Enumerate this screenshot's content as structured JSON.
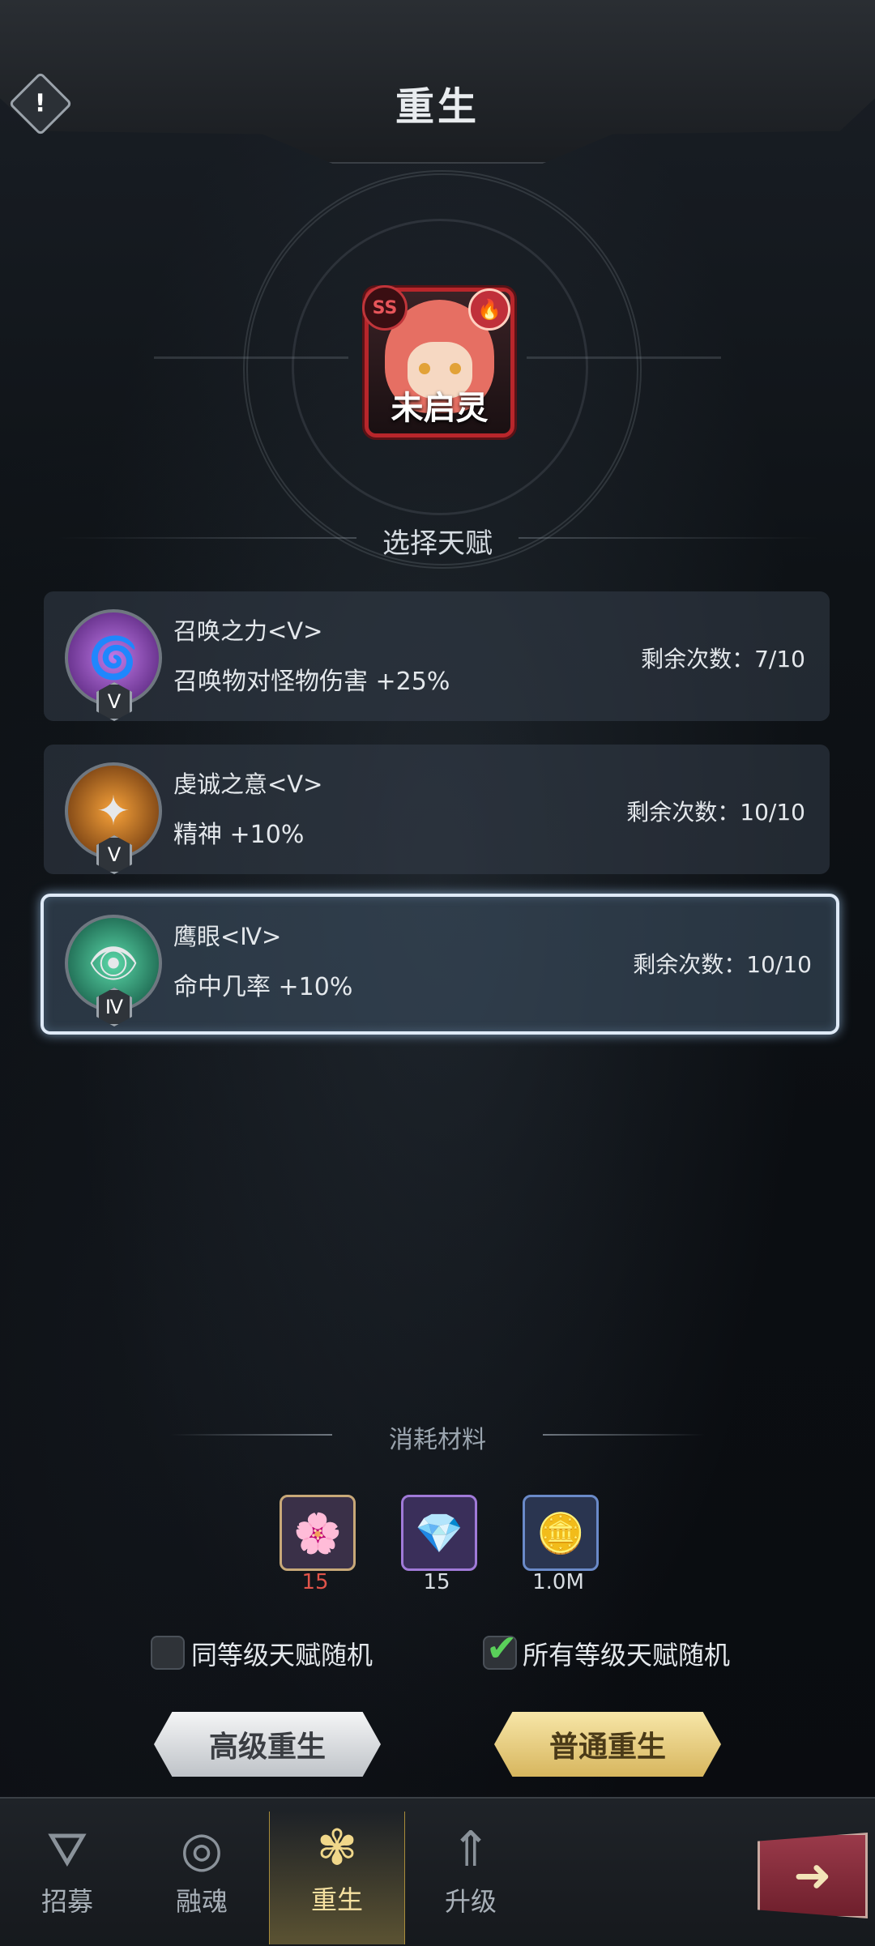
{
  "header": {
    "title": "重生",
    "info_icon": "exclamation-icon"
  },
  "character": {
    "name": "未启灵",
    "grade_badge": "SS",
    "element_icon": "fire-icon"
  },
  "select_label": "选择天赋",
  "talents": [
    {
      "name": "召唤之力<Ⅴ>",
      "effect": "召唤物对怪物伤害 +25%",
      "remaining": "剩余次数：7/10",
      "tier": "Ⅴ",
      "icon": "vortex-icon",
      "color": "#7a3aa8",
      "selected": false
    },
    {
      "name": "虔诚之意<Ⅴ>",
      "effect": "精神 +10%",
      "remaining": "剩余次数：10/10",
      "tier": "Ⅴ",
      "icon": "star-burst-icon",
      "color": "#d06a18",
      "selected": false
    },
    {
      "name": "鹰眼<Ⅳ>",
      "effect": "命中几率 +10%",
      "remaining": "剩余次数：10/10",
      "tier": "Ⅳ",
      "icon": "eagle-eye-icon",
      "color": "#1e7a5e",
      "selected": true
    }
  ],
  "materials": {
    "title": "消耗材料",
    "items": [
      {
        "icon": "flower-icon",
        "count": "15",
        "count_color": "#e0544a",
        "frame": "#c8a878",
        "bg": "#3a3048"
      },
      {
        "icon": "crystal-icon",
        "count": "15",
        "count_color": "#d8dde2",
        "frame": "#a07ad8",
        "bg": "#3a2f5a"
      },
      {
        "icon": "gold-coin-icon",
        "count": "1.0M",
        "count_color": "#d8dde2",
        "frame": "#6a8ac8",
        "bg": "#2a3550"
      }
    ]
  },
  "options": {
    "same_level": {
      "label": "同等级天赋随机",
      "checked": false
    },
    "all_levels": {
      "label": "所有等级天赋随机",
      "checked": true
    }
  },
  "buttons": {
    "advanced": "高级重生",
    "normal": "普通重生"
  },
  "nav": [
    {
      "label": "招募",
      "icon": "recruit-icon",
      "active": false
    },
    {
      "label": "融魂",
      "icon": "soul-fusion-icon",
      "active": false
    },
    {
      "label": "重生",
      "icon": "rebirth-icon",
      "active": true
    },
    {
      "label": "升级",
      "icon": "upgrade-icon",
      "active": false
    }
  ],
  "next_icon": "arrow-right-icon"
}
